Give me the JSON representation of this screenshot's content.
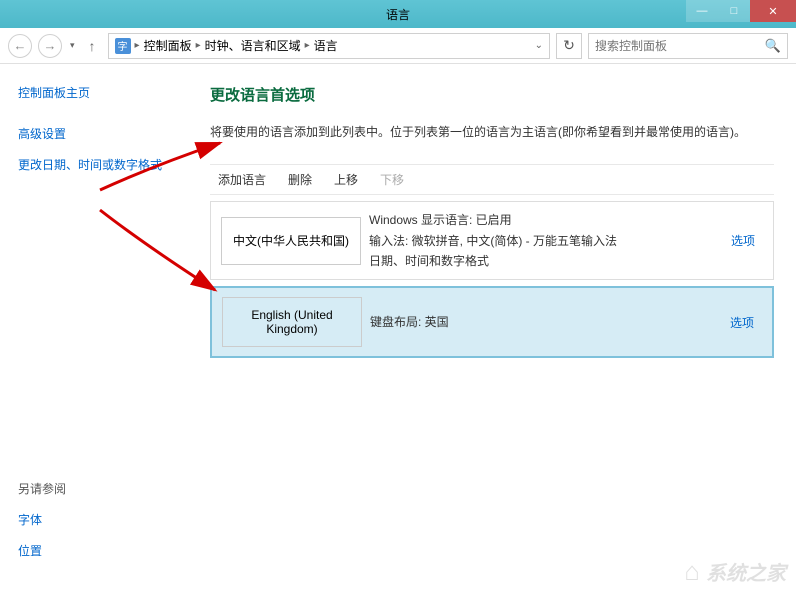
{
  "window": {
    "title": "语言"
  },
  "breadcrumbs": {
    "items": [
      "控制面板",
      "时钟、语言和区域",
      "语言"
    ]
  },
  "search": {
    "placeholder": "搜索控制面板"
  },
  "sidebar": {
    "home": "控制面板主页",
    "links": [
      "高级设置",
      "更改日期、时间或数字格式"
    ],
    "see_also_title": "另请参阅",
    "see_also": [
      "字体",
      "位置"
    ]
  },
  "main": {
    "title": "更改语言首选项",
    "description": "将要使用的语言添加到此列表中。位于列表第一位的语言为主语言(即你希望看到并最常使用的语言)。"
  },
  "toolbar": {
    "add": "添加语言",
    "remove": "删除",
    "move_up": "上移",
    "move_down": "下移"
  },
  "languages": [
    {
      "name": "中文(中华人民共和国)",
      "details": [
        "Windows 显示语言: 已启用",
        "输入法: 微软拼音, 中文(简体) - 万能五笔输入法",
        "日期、时间和数字格式"
      ],
      "options": "选项",
      "selected": false
    },
    {
      "name": "English (United Kingdom)",
      "details": [
        "键盘布局: 英国"
      ],
      "options": "选项",
      "selected": true
    }
  ],
  "watermark": "系统之家"
}
